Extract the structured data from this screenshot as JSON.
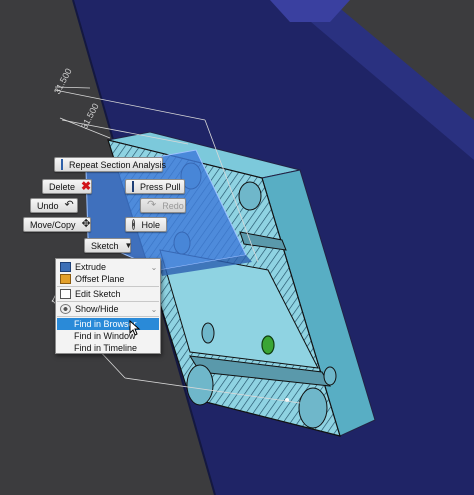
{
  "dimensions": {
    "outer": "31.500",
    "inner": "31.500"
  },
  "marking_menu": {
    "repeat_section_analysis": "Repeat Section Analysis",
    "delete": "Delete",
    "press_pull": "Press Pull",
    "undo": "Undo",
    "redo": "Redo",
    "move_copy": "Move/Copy",
    "hole": "Hole",
    "sketch": "Sketch"
  },
  "context_menu": {
    "items": [
      {
        "label": "Extrude",
        "icon": "extrude-icon"
      },
      {
        "label": "Offset Plane",
        "icon": "offset-plane-icon"
      },
      {
        "label": "Edit Sketch",
        "icon": "edit-sketch-icon"
      },
      {
        "label": "Show/Hide",
        "icon": "eye-icon"
      },
      {
        "label": "Find in Browser",
        "icon": ""
      },
      {
        "label": "Find in Window",
        "icon": ""
      },
      {
        "label": "Find in Timeline",
        "icon": ""
      }
    ],
    "highlighted": "Find in Browser"
  },
  "colors": {
    "background": "#3c3c3e",
    "wall": "#1f2466",
    "part": "#7cc9db",
    "selection": "#3f7bd9",
    "highlight": "#2a8ad8",
    "green_dot": "#3aa535"
  }
}
